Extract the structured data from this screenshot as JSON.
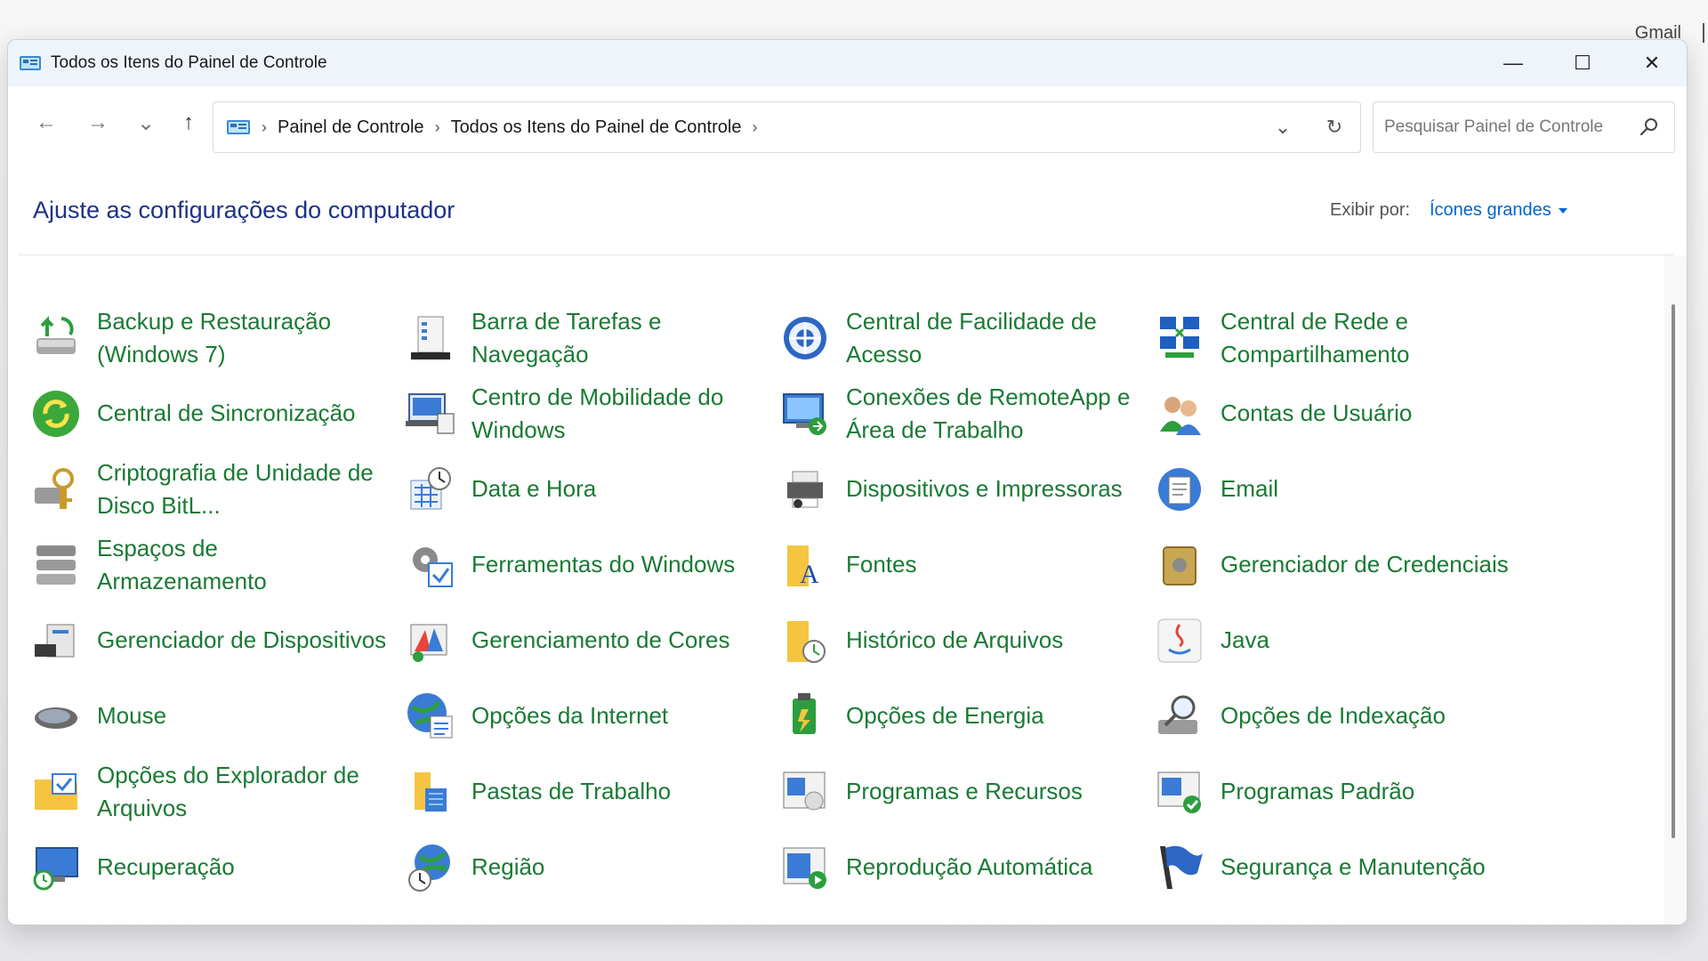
{
  "background": {
    "text": "Gmail"
  },
  "window": {
    "title": "Todos os Itens do Painel de Controle",
    "controls": {
      "minimize": "—",
      "maximize": "☐",
      "close": "✕"
    }
  },
  "nav": {
    "back": "←",
    "forward": "→",
    "recent": "⌄",
    "up": "↑",
    "breadcrumb": [
      "Painel de Controle",
      "Todos os Itens do Painel de Controle"
    ],
    "separator": "›",
    "dropdown": "⌄",
    "refresh": "↻"
  },
  "search": {
    "placeholder": "Pesquisar Painel de Controle"
  },
  "header": {
    "title": "Ajuste as configurações do computador",
    "view_by_label": "Exibir por:",
    "view_by_value": "Ícones grandes"
  },
  "colors": {
    "link": "#1a7a34",
    "heading": "#1e3287",
    "accent": "#0066cc"
  },
  "items": [
    {
      "label": "Backup e Restauração (Windows 7)",
      "icon": "backup-icon"
    },
    {
      "label": "Barra de Tarefas e Navegação",
      "icon": "taskbar-icon"
    },
    {
      "label": "Central de Facilidade de Acesso",
      "icon": "accessibility-icon"
    },
    {
      "label": "Central de Rede e Compartilhamento",
      "icon": "network-icon"
    },
    {
      "label": "Central de Sincronização",
      "icon": "sync-icon"
    },
    {
      "label": "Centro de Mobilidade do Windows",
      "icon": "mobility-icon"
    },
    {
      "label": "Conexões de RemoteApp e Área de Trabalho",
      "icon": "remoteapp-icon"
    },
    {
      "label": "Contas de Usuário",
      "icon": "users-icon"
    },
    {
      "label": "Criptografia de Unidade de Disco BitL...",
      "icon": "bitlocker-icon"
    },
    {
      "label": "Data e Hora",
      "icon": "datetime-icon"
    },
    {
      "label": "Dispositivos e Impressoras",
      "icon": "printer-icon"
    },
    {
      "label": "Email",
      "icon": "email-icon"
    },
    {
      "label": "Espaços de Armazenamento",
      "icon": "storage-icon"
    },
    {
      "label": "Ferramentas do Windows",
      "icon": "tools-icon"
    },
    {
      "label": "Fontes",
      "icon": "fonts-icon"
    },
    {
      "label": "Gerenciador de Credenciais",
      "icon": "credential-icon"
    },
    {
      "label": "Gerenciador de Dispositivos",
      "icon": "device-manager-icon"
    },
    {
      "label": "Gerenciamento de Cores",
      "icon": "color-icon"
    },
    {
      "label": "Histórico de Arquivos",
      "icon": "file-history-icon"
    },
    {
      "label": "Java",
      "icon": "java-icon"
    },
    {
      "label": "Mouse",
      "icon": "mouse-icon"
    },
    {
      "label": "Opções da Internet",
      "icon": "internet-icon"
    },
    {
      "label": "Opções de Energia",
      "icon": "power-icon"
    },
    {
      "label": "Opções de Indexação",
      "icon": "indexing-icon"
    },
    {
      "label": "Opções do Explorador de Arquivos",
      "icon": "folder-options-icon"
    },
    {
      "label": "Pastas de Trabalho",
      "icon": "work-folders-icon"
    },
    {
      "label": "Programas e Recursos",
      "icon": "programs-icon"
    },
    {
      "label": "Programas Padrão",
      "icon": "default-programs-icon"
    },
    {
      "label": "Recuperação",
      "icon": "recovery-icon"
    },
    {
      "label": "Região",
      "icon": "region-icon"
    },
    {
      "label": "Reprodução Automática",
      "icon": "autoplay-icon"
    },
    {
      "label": "Segurança e Manutenção",
      "icon": "security-flag-icon"
    }
  ]
}
